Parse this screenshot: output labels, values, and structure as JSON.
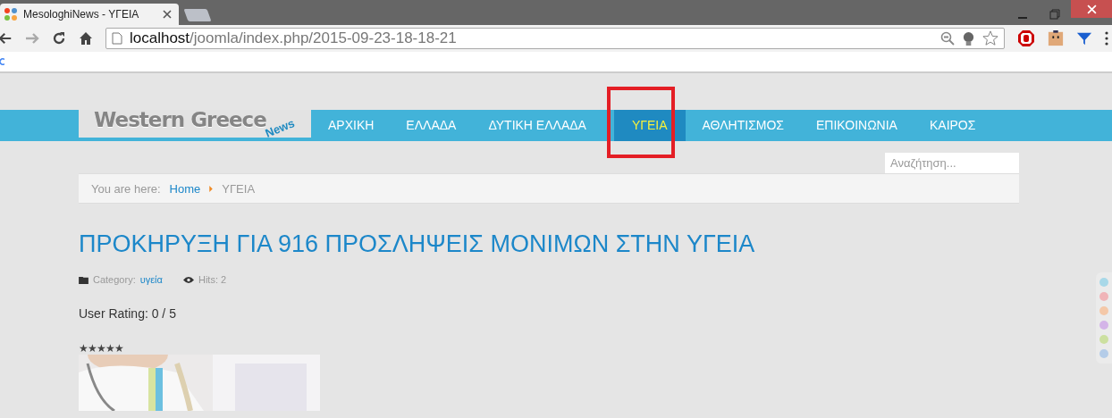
{
  "browser": {
    "tab_title": "MesologhiNews - ΥΓΕΙΑ",
    "url_host": "localhost",
    "url_path": "/joomla/index.php/2015-09-23-18-18-21"
  },
  "site": {
    "logo_title": "Western Greece",
    "logo_sub": "News"
  },
  "nav": [
    {
      "label": "ΑΡΧΙΚΗ",
      "selected": false,
      "annotated": false
    },
    {
      "label": "ΕΛΛΑΔΑ",
      "selected": false,
      "annotated": false
    },
    {
      "label": "ΔΥΤΙΚΗ ΕΛΛΑΔΑ",
      "selected": false,
      "annotated": false
    },
    {
      "label": "ΥΓΕΙΑ",
      "selected": true,
      "annotated": true
    },
    {
      "label": "ΑΘΛΗΤΙΣΜΟΣ",
      "selected": false,
      "annotated": false
    },
    {
      "label": "ΕΠΙΚΟΙΝΩΝΙΑ",
      "selected": false,
      "annotated": false
    },
    {
      "label": "ΚΑΙΡΟΣ",
      "selected": false,
      "annotated": false
    }
  ],
  "search": {
    "placeholder": "Αναζήτηση..."
  },
  "breadcrumb": {
    "label": "You are here:",
    "items": [
      "Home",
      "ΥΓΕΙΑ"
    ]
  },
  "article": {
    "title": "ΠΡΟΚΗΡΥΞΗ ΓΙΑ 916 ΠΡΟΣΛΗΨΕΙΣ ΜΟΝΙΜΩΝ ΣΤΗΝ ΥΓΕΙΑ",
    "category_label": "Category:",
    "category": "υγεία",
    "hits": "Hits: 2",
    "rating": "User Rating:  0 / 5",
    "stars": "★★★★★"
  },
  "color_switcher": [
    {
      "color": "#a8d8e8"
    },
    {
      "color": "#f0b4b8"
    },
    {
      "color": "#f4c8a8"
    },
    {
      "color": "#d4b4e8"
    },
    {
      "color": "#cce0a0"
    },
    {
      "color": "#b4cce8"
    }
  ]
}
